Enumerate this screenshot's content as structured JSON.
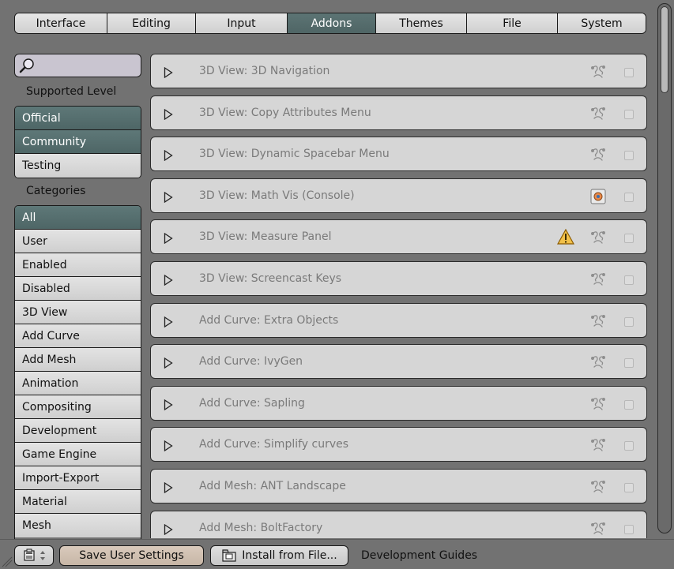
{
  "tabs": [
    {
      "label": "Interface",
      "active": false
    },
    {
      "label": "Editing",
      "active": false
    },
    {
      "label": "Input",
      "active": false
    },
    {
      "label": "Addons",
      "active": true
    },
    {
      "label": "Themes",
      "active": false
    },
    {
      "label": "File",
      "active": false
    },
    {
      "label": "System",
      "active": false
    }
  ],
  "sidebar": {
    "search_icon": "magnifier-icon",
    "supported_level_label": "Supported Level",
    "supported_levels": [
      {
        "label": "Official",
        "active": true
      },
      {
        "label": "Community",
        "active": true
      },
      {
        "label": "Testing",
        "active": false
      }
    ],
    "categories_label": "Categories",
    "categories": [
      {
        "label": "All",
        "active": true
      },
      {
        "label": "User",
        "active": false
      },
      {
        "label": "Enabled",
        "active": false
      },
      {
        "label": "Disabled",
        "active": false
      },
      {
        "label": "3D View",
        "active": false
      },
      {
        "label": "Add Curve",
        "active": false
      },
      {
        "label": "Add Mesh",
        "active": false
      },
      {
        "label": "Animation",
        "active": false
      },
      {
        "label": "Compositing",
        "active": false
      },
      {
        "label": "Development",
        "active": false
      },
      {
        "label": "Game Engine",
        "active": false
      },
      {
        "label": "Import-Export",
        "active": false
      },
      {
        "label": "Material",
        "active": false
      },
      {
        "label": "Mesh",
        "active": false
      }
    ]
  },
  "addons": [
    {
      "name": "3D View: 3D Navigation",
      "support_icon": "community-icon",
      "warning": false,
      "enabled": false
    },
    {
      "name": "3D View: Copy Attributes Menu",
      "support_icon": "community-icon",
      "warning": false,
      "enabled": false
    },
    {
      "name": "3D View: Dynamic Spacebar Menu",
      "support_icon": "community-icon",
      "warning": false,
      "enabled": false
    },
    {
      "name": "3D View: Math Vis (Console)",
      "support_icon": "official-icon",
      "warning": false,
      "enabled": false
    },
    {
      "name": "3D View: Measure Panel",
      "support_icon": "community-icon",
      "warning": true,
      "enabled": false
    },
    {
      "name": "3D View: Screencast Keys",
      "support_icon": "community-icon",
      "warning": false,
      "enabled": false
    },
    {
      "name": "Add Curve: Extra Objects",
      "support_icon": "community-icon",
      "warning": false,
      "enabled": false
    },
    {
      "name": "Add Curve: IvyGen",
      "support_icon": "community-icon",
      "warning": false,
      "enabled": false
    },
    {
      "name": "Add Curve: Sapling",
      "support_icon": "community-icon",
      "warning": false,
      "enabled": false
    },
    {
      "name": "Add Curve: Simplify curves",
      "support_icon": "community-icon",
      "warning": false,
      "enabled": false
    },
    {
      "name": "Add Mesh: ANT Landscape",
      "support_icon": "community-icon",
      "warning": false,
      "enabled": false
    },
    {
      "name": "Add Mesh: BoltFactory",
      "support_icon": "community-icon",
      "warning": false,
      "enabled": false
    }
  ],
  "bottom": {
    "editor_type_icon": "preferences-editor-icon",
    "save_label": "Save User Settings",
    "install_icon": "folder-icon",
    "install_label": "Install from File...",
    "dev_guides_label": "Development Guides"
  },
  "colors": {
    "background": "#727272",
    "active_tab": "#56706f",
    "addon_box": "#d6d6d6",
    "save_button": "#d0c0b0"
  }
}
